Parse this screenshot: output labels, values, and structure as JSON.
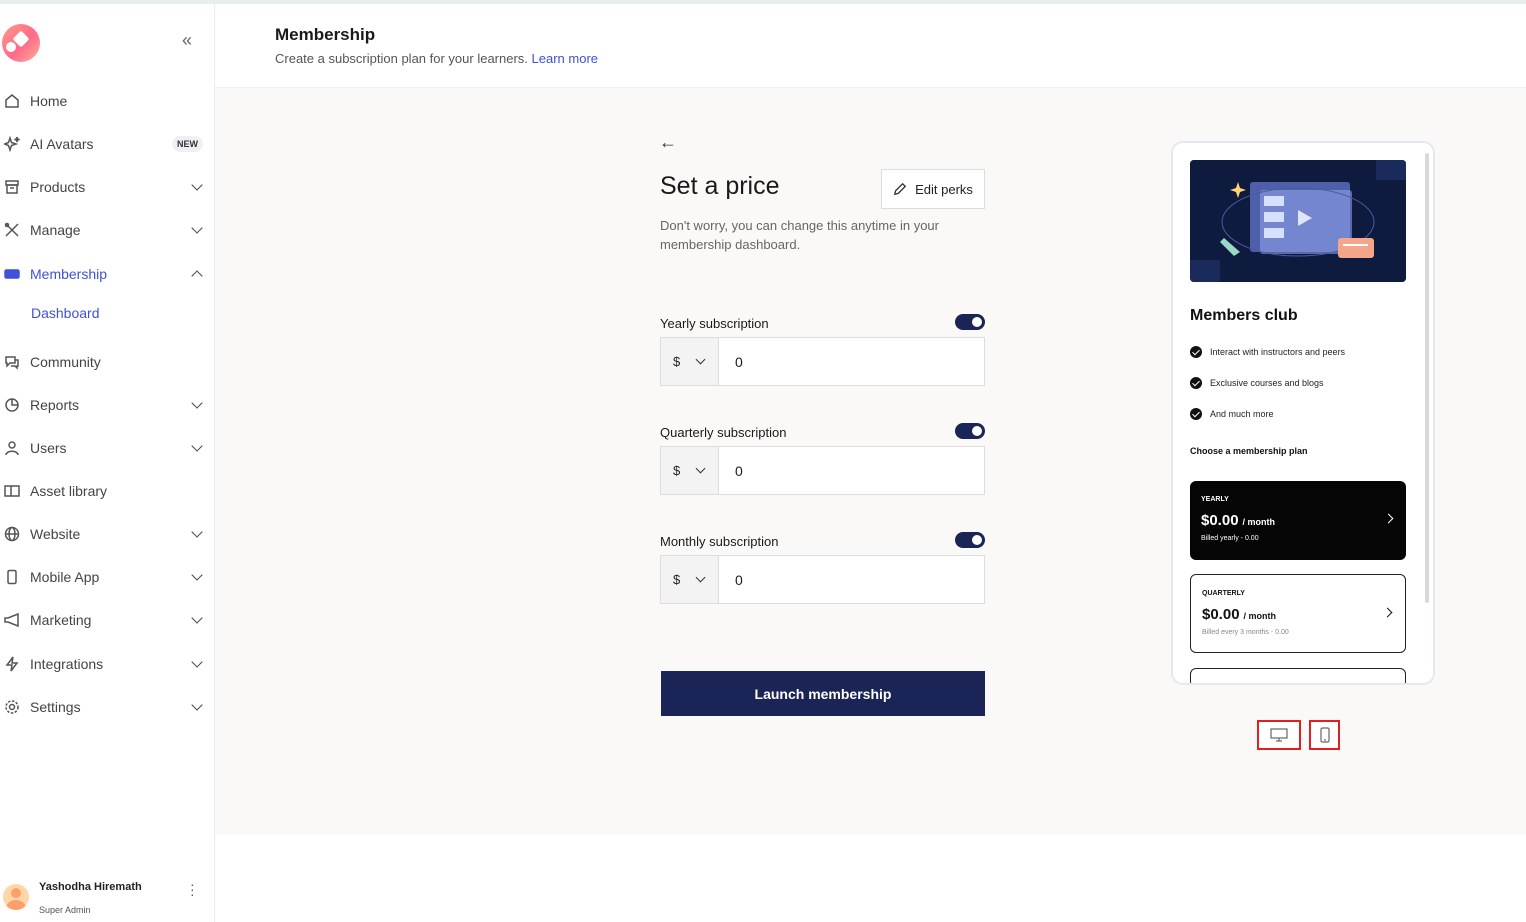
{
  "sidebar": {
    "items": [
      {
        "label": "Home",
        "icon": "home-icon"
      },
      {
        "label": "AI Avatars",
        "icon": "sparkle-icon",
        "badge": "NEW"
      },
      {
        "label": "Products",
        "icon": "box-icon"
      },
      {
        "label": "Manage",
        "icon": "tools-icon"
      },
      {
        "label": "Membership",
        "icon": "ticket-icon"
      },
      {
        "label": "Community",
        "icon": "chat-icon"
      },
      {
        "label": "Reports",
        "icon": "pie-chart-icon"
      },
      {
        "label": "Users",
        "icon": "user-icon"
      },
      {
        "label": "Asset library",
        "icon": "book-icon"
      },
      {
        "label": "Website",
        "icon": "globe-icon"
      },
      {
        "label": "Mobile App",
        "icon": "mobile-icon"
      },
      {
        "label": "Marketing",
        "icon": "megaphone-icon"
      },
      {
        "label": "Integrations",
        "icon": "bolt-icon"
      },
      {
        "label": "Settings",
        "icon": "gear-icon"
      }
    ],
    "membership_sub": {
      "label": "Dashboard"
    },
    "user": {
      "name": "Yashodha Hiremath",
      "role": "Super Admin"
    }
  },
  "header": {
    "title": "Membership",
    "subtitle": "Create a subscription plan for your learners.",
    "link": "Learn more"
  },
  "main": {
    "title": "Set a price",
    "edit_perks": "Edit perks",
    "description": "Don't worry, you can change this anytime in your membership dashboard.",
    "subscriptions": [
      {
        "label": "Yearly subscription",
        "currency": "$",
        "amount": "0",
        "enabled": true
      },
      {
        "label": "Quarterly subscription",
        "currency": "$",
        "amount": "0",
        "enabled": true
      },
      {
        "label": "Monthly subscription",
        "currency": "$",
        "amount": "0",
        "enabled": true
      }
    ],
    "launch": "Launch membership"
  },
  "preview": {
    "title": "Members club",
    "perks": [
      "Interact with instructors and peers",
      "Exclusive courses and blogs",
      "And much more"
    ],
    "choose": "Choose a membership plan",
    "plans": [
      {
        "name": "YEARLY",
        "price": "$0.00",
        "per": "/ month",
        "billing": "Billed yearly - 0.00"
      },
      {
        "name": "QUARTERLY",
        "price": "$0.00",
        "per": "/ month",
        "billing": "Billed every 3 months - 0.00"
      }
    ]
  },
  "colors": {
    "accent": "#3f51d6",
    "primary_dark": "#1a2456",
    "highlight": "#e02020"
  }
}
